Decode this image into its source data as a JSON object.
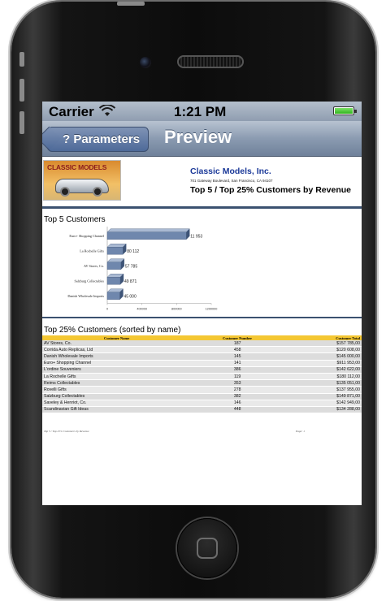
{
  "status_bar": {
    "carrier": "Carrier",
    "wifi_icon": "wifi-icon",
    "time": "1:21 PM",
    "battery_icon": "battery-icon",
    "battery_color": "#2fb31c"
  },
  "nav": {
    "back_label": "? Parameters",
    "title": "Preview"
  },
  "report_header": {
    "logo_text": "CLASSIC MODELS",
    "company": "Classic Models, Inc.",
    "address": "701 Gateway Boulevard, San Francisco, CA 94107",
    "report_title": "Top 5 / Top 25% Customers by Revenue"
  },
  "top5": {
    "title": "Top 5 Customers"
  },
  "chart_data": {
    "type": "bar",
    "orientation": "horizontal",
    "categories": [
      "Euro+ Shopping Channel",
      "La Rochelle Gifts",
      "AV Stores, Co.",
      "Salzburg Collectables",
      "Danish Wholesale Imports"
    ],
    "values": [
      911953,
      180112,
      157785,
      149871,
      145000
    ],
    "value_labels": [
      "11 953",
      "80 112",
      "57 785",
      "49 871",
      "45 000"
    ],
    "x_ticks": [
      "0",
      "400000",
      "800000",
      "1200000"
    ],
    "x_tick_values": [
      0,
      400000,
      800000,
      1200000
    ],
    "xlim": [
      0,
      1200000
    ],
    "bar_color": "#6f87ad",
    "grid": false
  },
  "top25": {
    "title": "Top 25% Customers (sorted by name)",
    "headers": [
      "Customer Name",
      "Customer Number",
      "Customer Total"
    ],
    "header_color": "#f4c733",
    "rows": [
      [
        "AV Stores, Co.",
        "187",
        "$157 785,00"
      ],
      [
        "Corrida Auto Replicas, Ltd",
        "458",
        "$120 608,00"
      ],
      [
        "Danish Wholesale Imports",
        "145",
        "$145 000,00"
      ],
      [
        "Euro+ Shopping Channel",
        "141",
        "$911 953,00"
      ],
      [
        "L'ordine Souveniers",
        "386",
        "$142 622,00"
      ],
      [
        "La Rochelle Gifts",
        "119",
        "$180 112,00"
      ],
      [
        "Reims Collectables",
        "353",
        "$135 051,00"
      ],
      [
        "Rovelli Gifts",
        "278",
        "$137 955,00"
      ],
      [
        "Salzburg Collectables",
        "382",
        "$149 871,00"
      ],
      [
        "Saveley & Henriot, Co.",
        "146",
        "$142 949,00"
      ],
      [
        "Scandinavian Gift Ideas",
        "448",
        "$134 288,00"
      ]
    ]
  },
  "footer": {
    "left": "Top 5 / Top 25% Customers by Revenue",
    "right": "Page: 1"
  }
}
